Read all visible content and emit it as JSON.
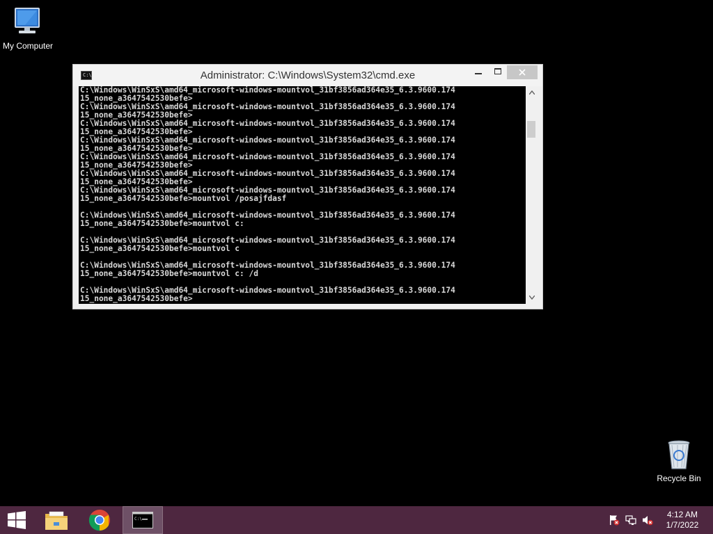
{
  "desktop": {
    "icons": [
      {
        "label": "My Computer",
        "icon": "computer-icon"
      },
      {
        "label": "Recycle Bin",
        "icon": "recycle-bin-icon"
      }
    ]
  },
  "window": {
    "title": "Administrator: C:\\Windows\\System32\\cmd.exe",
    "buttons": {
      "minimize": "minimize-icon",
      "maximize": "maximize-icon",
      "close": "close-icon"
    },
    "console_lines": [
      "C:\\Windows\\WinSxS\\amd64_microsoft-windows-mountvol_31bf3856ad364e35_6.3.9600.174",
      "15_none_a3647542530befe>",
      "C:\\Windows\\WinSxS\\amd64_microsoft-windows-mountvol_31bf3856ad364e35_6.3.9600.174",
      "15_none_a3647542530befe>",
      "C:\\Windows\\WinSxS\\amd64_microsoft-windows-mountvol_31bf3856ad364e35_6.3.9600.174",
      "15_none_a3647542530befe>",
      "C:\\Windows\\WinSxS\\amd64_microsoft-windows-mountvol_31bf3856ad364e35_6.3.9600.174",
      "15_none_a3647542530befe>",
      "C:\\Windows\\WinSxS\\amd64_microsoft-windows-mountvol_31bf3856ad364e35_6.3.9600.174",
      "15_none_a3647542530befe>",
      "C:\\Windows\\WinSxS\\amd64_microsoft-windows-mountvol_31bf3856ad364e35_6.3.9600.174",
      "15_none_a3647542530befe>",
      "C:\\Windows\\WinSxS\\amd64_microsoft-windows-mountvol_31bf3856ad364e35_6.3.9600.174",
      "15_none_a3647542530befe>mountvol /posajfdasf",
      "",
      "C:\\Windows\\WinSxS\\amd64_microsoft-windows-mountvol_31bf3856ad364e35_6.3.9600.174",
      "15_none_a3647542530befe>mountvol c:",
      "",
      "C:\\Windows\\WinSxS\\amd64_microsoft-windows-mountvol_31bf3856ad364e35_6.3.9600.174",
      "15_none_a3647542530befe>mountvol c",
      "",
      "C:\\Windows\\WinSxS\\amd64_microsoft-windows-mountvol_31bf3856ad364e35_6.3.9600.174",
      "15_none_a3647542530befe>mountvol c: /d",
      "",
      "C:\\Windows\\WinSxS\\amd64_microsoft-windows-mountvol_31bf3856ad364e35_6.3.9600.174",
      "15_none_a3647542530befe>"
    ]
  },
  "taskbar": {
    "items": [
      {
        "name": "start-button",
        "icon": "windows-logo-icon"
      },
      {
        "name": "file-explorer",
        "icon": "folder-icon"
      },
      {
        "name": "chrome",
        "icon": "chrome-icon"
      },
      {
        "name": "command-prompt",
        "icon": "cmd-icon",
        "active": true
      }
    ],
    "tray_icons": [
      "action-center-flag-icon",
      "network-icon",
      "volume-muted-icon"
    ],
    "clock": {
      "time": "4:12 AM",
      "date": "1/7/2022"
    }
  },
  "colors": {
    "taskbar": "#4e2740",
    "console_bg": "#000000",
    "console_text": "#d8d8d8",
    "desktop_bg": "#000000"
  }
}
